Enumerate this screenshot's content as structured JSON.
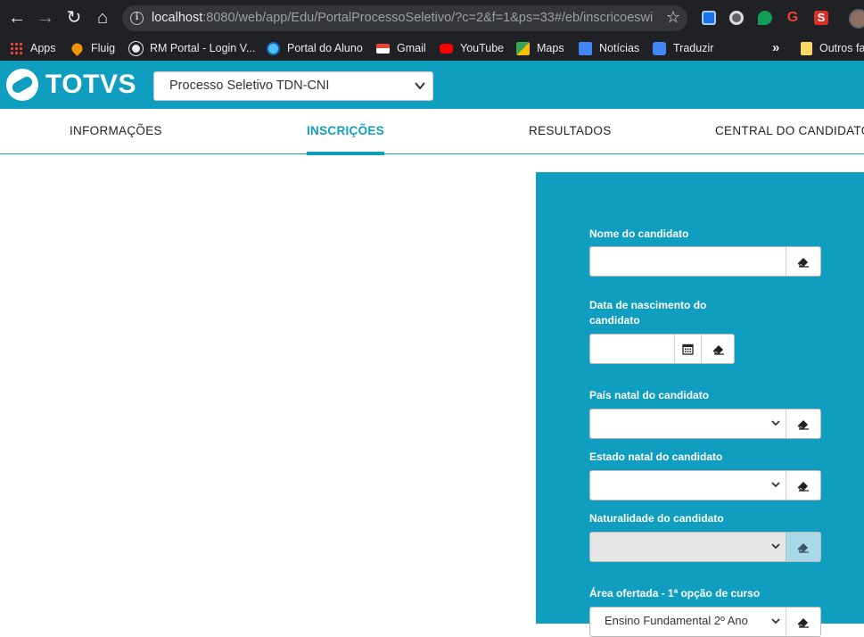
{
  "browser": {
    "url_host": "localhost",
    "url_rest": ":8080/web/app/Edu/PortalProcessoSeletivo/?c=2&f=1&ps=33#/eb/inscricoeswi...",
    "bookmarks": [
      {
        "label": "Apps",
        "icon": "apps-icon"
      },
      {
        "label": "Fluig",
        "icon": "fluig-icon"
      },
      {
        "label": "RM Portal - Login V...",
        "icon": "globe-icon"
      },
      {
        "label": "Portal do Aluno",
        "icon": "portal-aluno-icon"
      },
      {
        "label": "Gmail",
        "icon": "gmail-icon"
      },
      {
        "label": "YouTube",
        "icon": "youtube-icon"
      },
      {
        "label": "Maps",
        "icon": "maps-icon"
      },
      {
        "label": "Notícias",
        "icon": "news-icon"
      },
      {
        "label": "Traduzir",
        "icon": "translate-icon"
      }
    ],
    "bookmarks_overflow": "»",
    "other_bookmarks": "Outros fa"
  },
  "header": {
    "logo_text": "TOTVS",
    "process_select_value": "Processo Seletivo TDN-CNI",
    "brand_color": "#0f9ec0"
  },
  "tabs": [
    {
      "label": "INFORMAÇÕES",
      "active": false
    },
    {
      "label": "INSCRIÇÕES",
      "active": true
    },
    {
      "label": "RESULTADOS",
      "active": false
    },
    {
      "label": "CENTRAL DO CANDIDATO",
      "active": false
    }
  ],
  "form": {
    "nome_label": "Nome do candidato",
    "nome_value": "",
    "nascimento_label_line1": "Data de nascimento do",
    "nascimento_label_line2": "candidato",
    "nascimento_value": "",
    "pais_label": "País natal do candidato",
    "pais_value": "",
    "estado_label": "Estado natal do candidato",
    "estado_value": "",
    "naturalidade_label": "Naturalidade do candidato",
    "naturalidade_value": "",
    "area_label": "Área ofertada - 1ª opção de curso",
    "area_value": "Ensino Fundamental 2º Ano"
  }
}
